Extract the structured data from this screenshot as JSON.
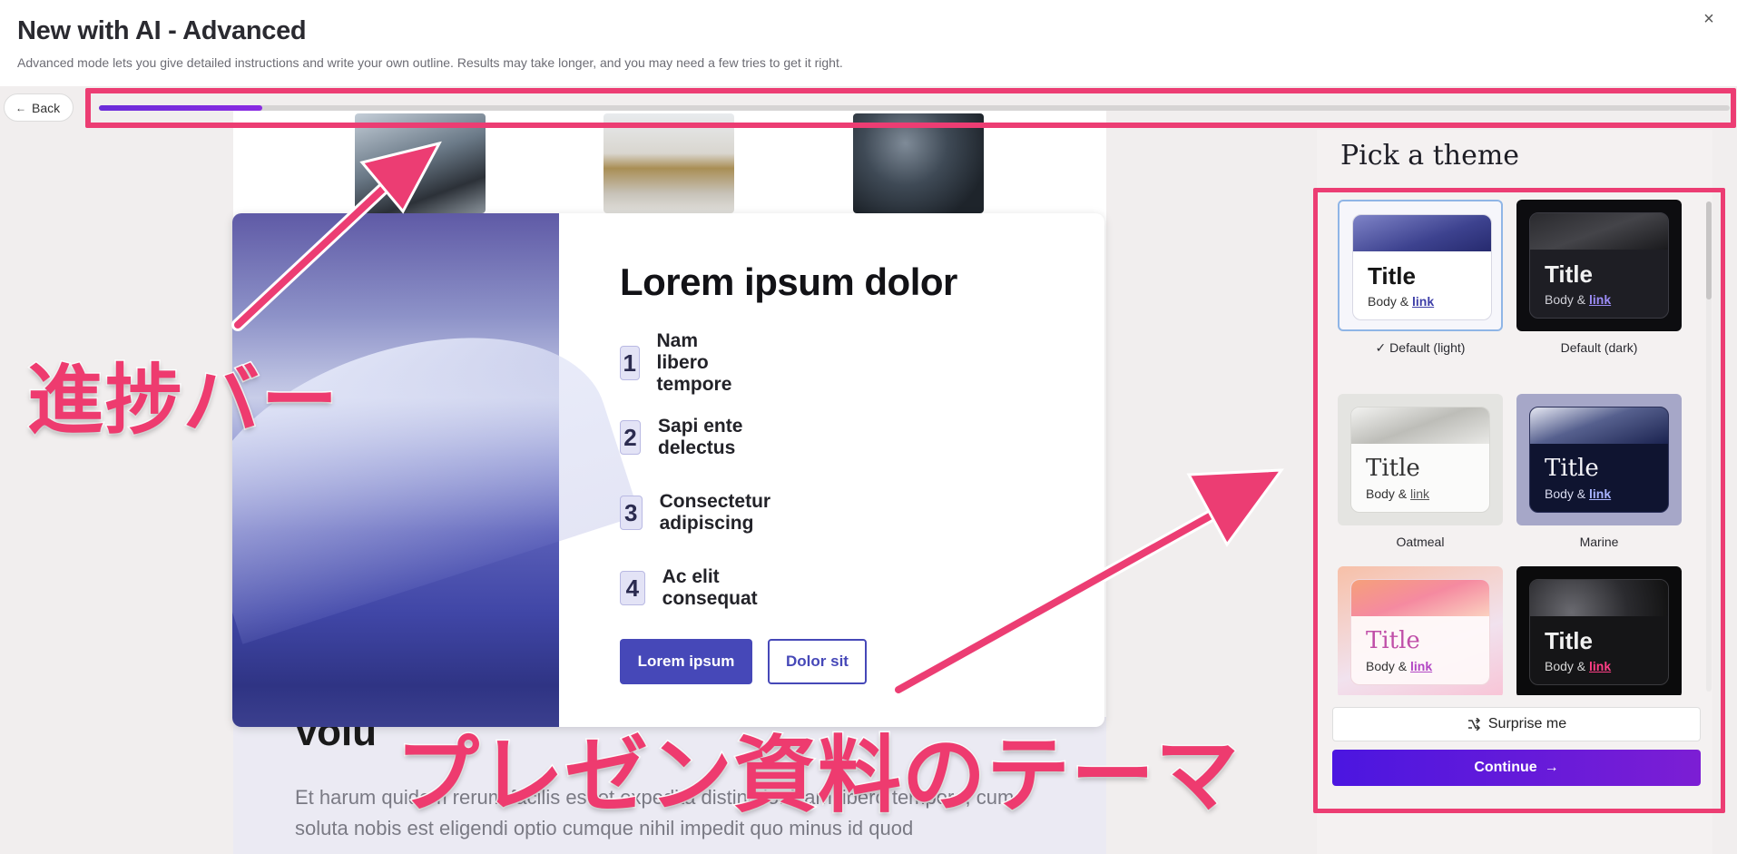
{
  "header": {
    "title": "New with AI - Advanced",
    "subtitle": "Advanced mode lets you give detailed instructions and write your own outline. Results may take longer, and you may need a few tries to get it right.",
    "close_icon": "×"
  },
  "nav": {
    "back_label": "Back",
    "back_icon": "←"
  },
  "progress": {
    "value_fraction": 0.1,
    "fill_color": "#7a22dc"
  },
  "preview": {
    "card": {
      "title": "Lorem ipsum dolor",
      "items": [
        {
          "num": "1",
          "text": "Nam libero tempore"
        },
        {
          "num": "2",
          "text": "Sapi ente delectus"
        },
        {
          "num": "3",
          "text": "Consectetur adipiscing"
        },
        {
          "num": "4",
          "text": "Ac elit consequat"
        }
      ],
      "primary_button": "Lorem ipsum",
      "secondary_button": "Dolor sit"
    },
    "background": {
      "heading_partial": "Volu",
      "paragraph": "Et harum quidem rerum facilis est et expedita distinctio. Nam libero tempore, cum soluta nobis est eligendi optio cumque nihil impedit quo minus id quod"
    }
  },
  "theme_panel": {
    "title": "Pick a theme",
    "themes": [
      {
        "name": "Default (light)",
        "selected": true,
        "check_icon": "✓",
        "title": "Title",
        "body": "Body &",
        "link": "link"
      },
      {
        "name": "Default (dark)",
        "selected": false,
        "title": "Title",
        "body": "Body &",
        "link": "link"
      },
      {
        "name": "Oatmeal",
        "selected": false,
        "title": "Title",
        "body": "Body &",
        "link": "link"
      },
      {
        "name": "Marine",
        "selected": false,
        "title": "Title",
        "body": "Body &",
        "link": "link"
      },
      {
        "name": "",
        "selected": false,
        "title": "Title",
        "body": "Body &",
        "link": "link"
      },
      {
        "name": "",
        "selected": false,
        "title": "Title",
        "body": "Body &",
        "link": "link"
      }
    ],
    "surprise_label": "Surprise me",
    "surprise_icon": "shuffle-icon",
    "continue_label": "Continue",
    "continue_icon": "→"
  },
  "annotations": {
    "progress_label": "進捗バー",
    "theme_label": "プレゼン資料のテーマ",
    "color": "#ec3d73"
  }
}
